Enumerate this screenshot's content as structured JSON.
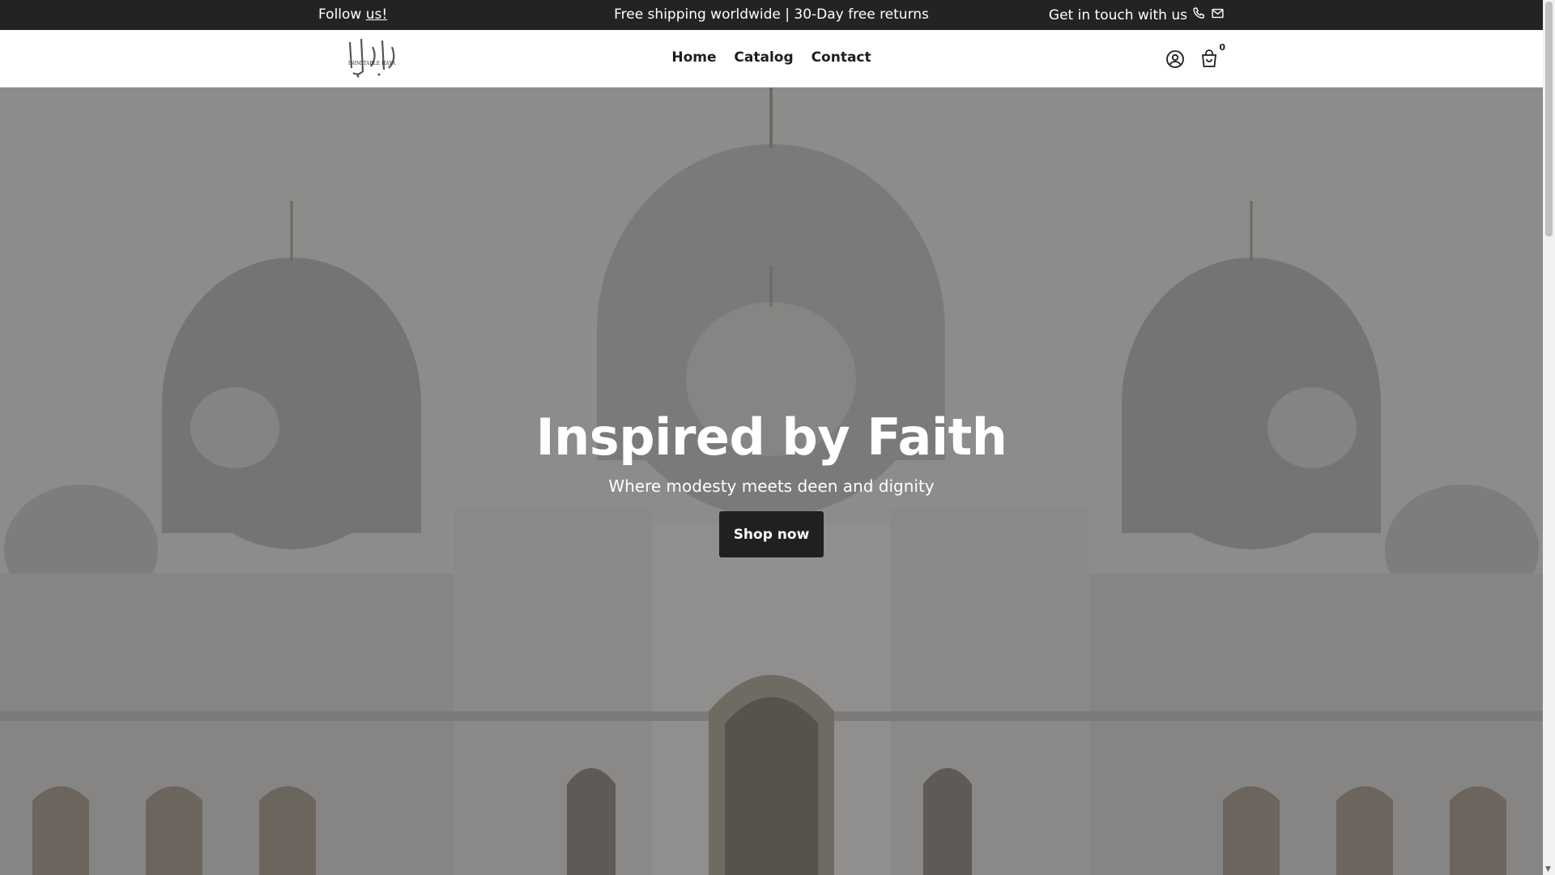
{
  "announcement": {
    "follow_prefix": "Follow",
    "follow_link": "us!",
    "center_text": "Free shipping worldwide | 30-Day free returns",
    "contact_text": "Get in touch with us"
  },
  "header": {
    "logo_text": "INIMITABLE HAYA",
    "logo_arabic": "إيمانيا",
    "nav": [
      "Home",
      "Catalog",
      "Contact"
    ],
    "cart_count": "0"
  },
  "hero": {
    "title": "Inspired by Faith",
    "subtitle": "Where modesty meets deen and dignity",
    "button_label": "Shop now"
  },
  "colors": {
    "topbar": "#222421",
    "button": "#1f211e",
    "text": "#1e1e1e"
  }
}
